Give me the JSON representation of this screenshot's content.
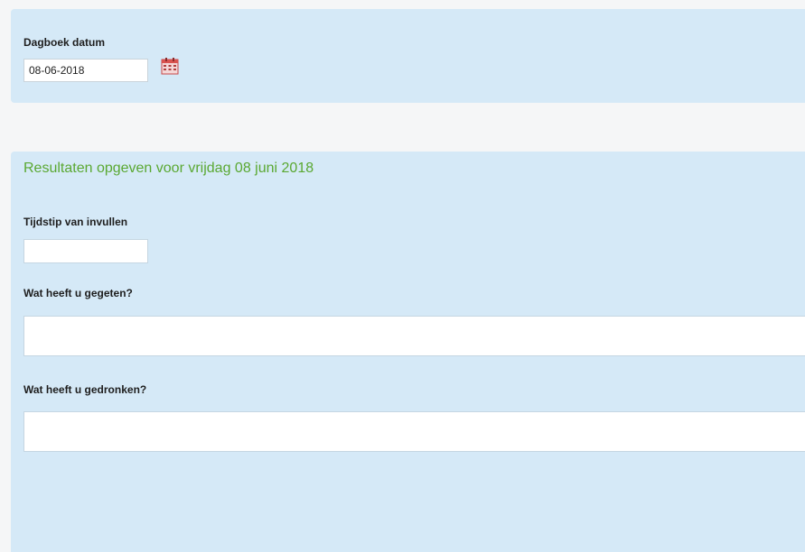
{
  "diary_date": {
    "label": "Dagboek datum",
    "value": "08-06-2018",
    "calendar_icon": "calendar-icon"
  },
  "results": {
    "title": "Resultaten opgeven voor vrijdag 08 juni 2018",
    "title_color": "#5aa832",
    "time": {
      "label": "Tijdstip van invullen",
      "value": ""
    },
    "food": {
      "label": "Wat heeft u gegeten?",
      "value": ""
    },
    "drink": {
      "label": "Wat heeft u gedronken?",
      "value": ""
    }
  },
  "colors": {
    "panel_background": "#d5e9f7",
    "page_background": "#f5f6f7",
    "input_background": "#ffffff"
  }
}
